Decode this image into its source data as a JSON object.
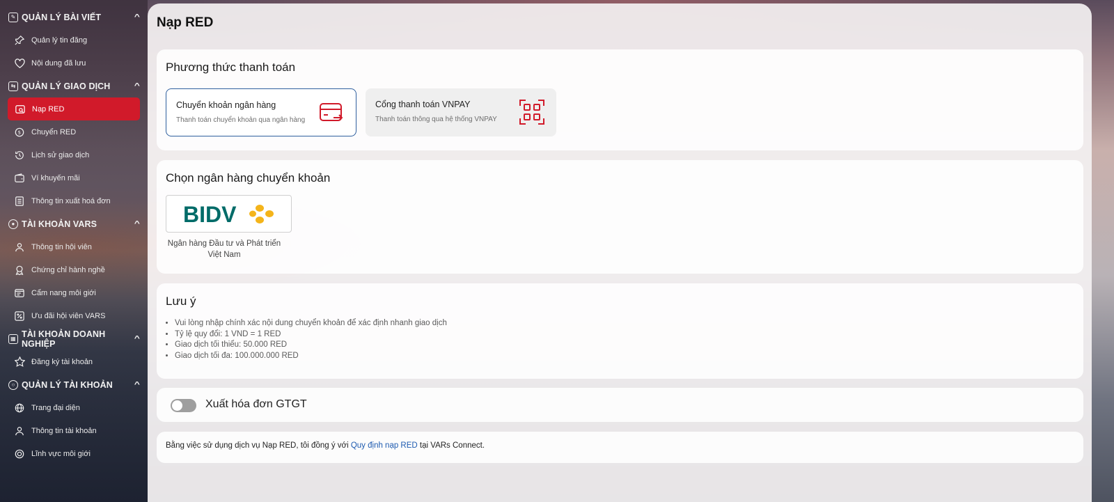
{
  "sidebar": {
    "sections": [
      {
        "title": "QUẢN LÝ BÀI VIẾT",
        "items": [
          "Quản lý tin đăng",
          "Nội dung đã lưu"
        ]
      },
      {
        "title": "QUẢN LÝ GIAO DỊCH",
        "items": [
          "Nạp RED",
          "Chuyển RED",
          "Lịch sử giao dịch",
          "Ví khuyến mãi",
          "Thông tin xuất hoá đơn"
        ]
      },
      {
        "title": "TÀI KHOẢN VARS",
        "items": [
          "Thông tin hội viên",
          "Chứng chỉ hành nghề",
          "Cẩm nang môi giới",
          "Ưu đãi hội viên VARS"
        ]
      },
      {
        "title": "TÀI KHOẢN DOANH NGHIỆP",
        "items": [
          "Đăng ký tài khoản"
        ]
      },
      {
        "title": "QUẢN LÝ TÀI KHOẢN",
        "items": [
          "Trang đại diện",
          "Thông tin tài khoản",
          "Lĩnh vực môi giới"
        ]
      }
    ],
    "active_item": "Nạp RED"
  },
  "page": {
    "title": "Nạp RED"
  },
  "payment": {
    "heading": "Phương thức thanh toán",
    "methods": [
      {
        "title": "Chuyển khoản ngân hàng",
        "desc": "Thanh toán chuyển khoản qua ngân hàng",
        "icon": "card-transfer-icon",
        "selected": true
      },
      {
        "title": "Cổng thanh toán VNPAY",
        "desc": "Thanh toán thông qua hệ thống VNPAY",
        "icon": "qr-scan-icon",
        "selected": false
      }
    ]
  },
  "bank": {
    "heading": "Chọn ngân hàng chuyển khoản",
    "logo_text": "BIDV",
    "name": "Ngân hàng Đầu tư và Phát triển Việt Nam"
  },
  "notes": {
    "heading": "Lưu ý",
    "items": [
      "Vui lòng nhập chính xác nội dung chuyển khoản để xác định nhanh giao dịch",
      "Tỷ lệ quy đổi: 1 VND = 1 RED",
      "Giao dịch tối thiểu: 50.000 RED",
      "Giao dịch tối đa: 100.000.000 RED"
    ]
  },
  "invoice": {
    "label": "Xuất hóa đơn GTGT",
    "enabled": false
  },
  "terms": {
    "prefix": "Bằng việc sử dụng dịch vụ Nạp RED, tôi đồng ý với ",
    "link": "Quy định nạp RED",
    "suffix": " tại VARs Connect."
  },
  "colors": {
    "accent": "#d11a2a",
    "link": "#1e5bb0",
    "bidv_green": "#006b68",
    "bidv_gold": "#f4b41a"
  }
}
